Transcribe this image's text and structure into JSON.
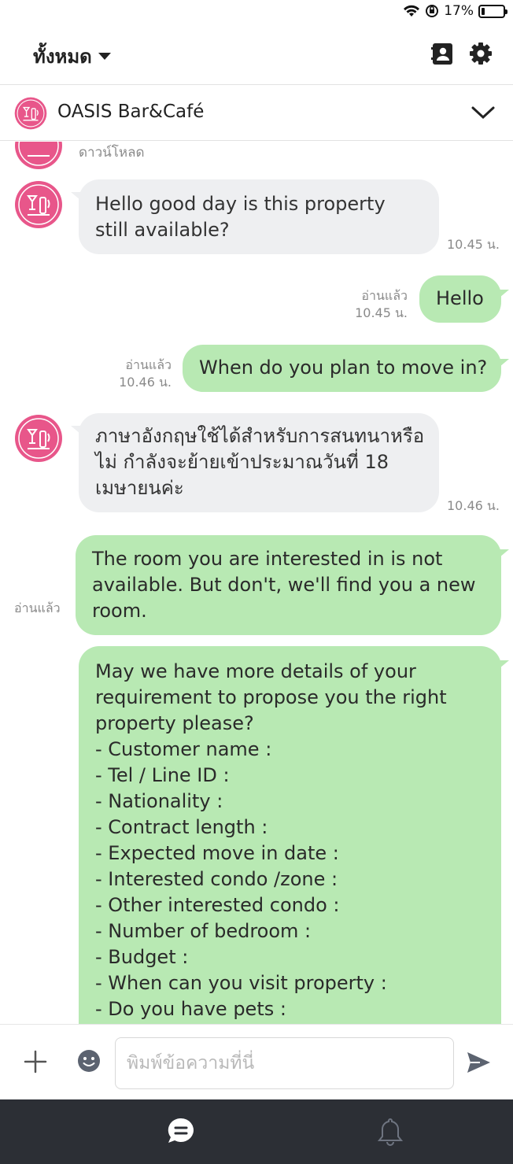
{
  "status_bar": {
    "battery": "17%",
    "battery_level": 0.17
  },
  "header": {
    "filter_label": "ทั้งหมด"
  },
  "chat": {
    "title": "OASIS Bar&Café"
  },
  "messages": {
    "download_label": "ดาวน์โหลด",
    "m1": {
      "text": "Hello good day is this property still available?",
      "time": "10.45 น."
    },
    "m2": {
      "text": "Hello",
      "read": "อ่านแล้ว",
      "time": "10.45 น."
    },
    "m3": {
      "text": "When do you plan to move in?",
      "read": "อ่านแล้ว",
      "time": "10.46 น."
    },
    "m4": {
      "text": "ภาษาอังกฤษใช้ได้สำหรับการสนทนาหรือไม่  กำลังจะย้ายเข้าประมาณวันที่ 18 เมษายนค่ะ",
      "time": "10.46 น."
    },
    "m5": {
      "text": "The room you are interested in is not available.  But don't, we'll find you a new room.",
      "read": "อ่านแล้ว"
    },
    "m6": {
      "intro": "May we have more details of your requirement to propose you the right property please?",
      "items": [
        "- Customer name :",
        "- Tel / Line ID :",
        "- Nationality :",
        "- Contract length :",
        "- Expected move in date :",
        "- Interested condo /zone :",
        "- Other interested condo :",
        "- Number of bedroom  :",
        "- Budget :",
        "- When can you visit property :",
        "- Do you have pets :"
      ]
    }
  },
  "composer": {
    "placeholder": "พิมพ์ข้อความที่นี่"
  },
  "colors": {
    "incoming_bubble": "#eeeff1",
    "outgoing_bubble": "#b8e9b3",
    "brand_pink": "#e8568a",
    "nav_bg": "#2c2f35"
  }
}
